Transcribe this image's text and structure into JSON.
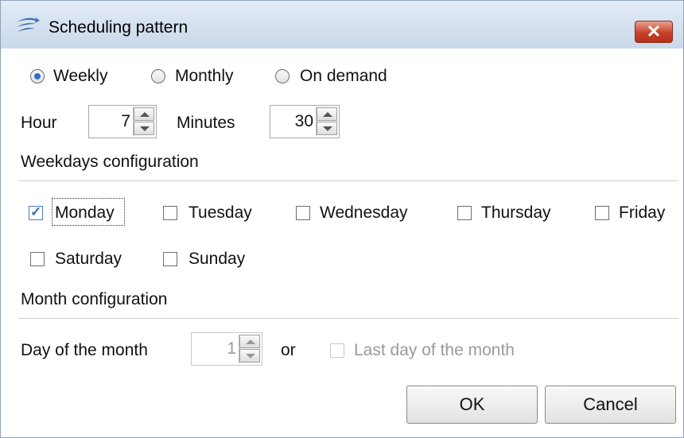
{
  "window": {
    "title": "Scheduling pattern",
    "close_label": "✕"
  },
  "schedule_type": {
    "options": [
      {
        "label": "Weekly",
        "selected": true
      },
      {
        "label": "Monthly",
        "selected": false
      },
      {
        "label": "On demand",
        "selected": false
      }
    ]
  },
  "time": {
    "hour_label": "Hour",
    "hour_value": "7",
    "minutes_label": "Minutes",
    "minutes_value": "30"
  },
  "weekdays": {
    "section_label": "Weekdays configuration",
    "days": [
      {
        "label": "Monday",
        "checked": true
      },
      {
        "label": "Tuesday",
        "checked": false
      },
      {
        "label": "Wednesday",
        "checked": false
      },
      {
        "label": "Thursday",
        "checked": false
      },
      {
        "label": "Friday",
        "checked": false
      },
      {
        "label": "Saturday",
        "checked": false
      },
      {
        "label": "Sunday",
        "checked": false
      }
    ]
  },
  "month": {
    "section_label": "Month configuration",
    "day_label": "Day of the month",
    "day_value": "1",
    "or_label": "or",
    "last_day_label": "Last day of the month",
    "last_day_checked": false
  },
  "buttons": {
    "ok_label": "OK",
    "cancel_label": "Cancel"
  }
}
